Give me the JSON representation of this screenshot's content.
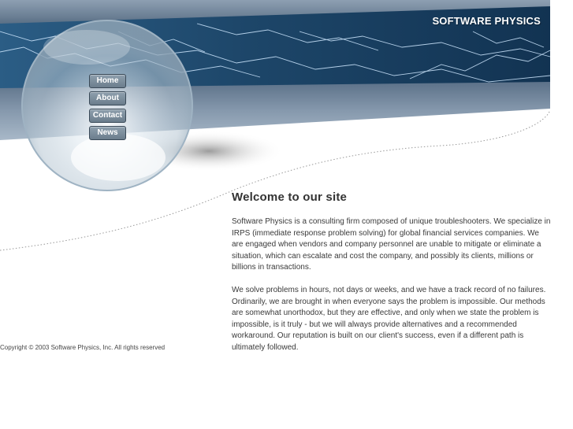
{
  "header": {
    "site_title": "SOFTWARE PHYSICS"
  },
  "nav": {
    "items": [
      {
        "label": "Home"
      },
      {
        "label": "About"
      },
      {
        "label": "Contact"
      },
      {
        "label": "News"
      }
    ]
  },
  "main": {
    "title": "Welcome to our site",
    "paragraphs": [
      "Software Physics is a consulting firm composed of unique troubleshooters. We specialize in IRPS (immediate response problem solving) for global financial services companies. We are engaged when vendors and company personnel are unable to mitigate or eliminate a situation, which can escalate and cost the company, and possibly its clients, millions or billions in transactions.",
      "We solve problems in hours, not days or weeks, and we have a track record of no failures. Ordinarily, we are brought in when everyone says the problem is impossible. Our methods are somewhat unorthodox, but they are effective, and only when we state the problem is impossible, is it truly - but we will always provide alternatives and a recommended workaround. Our reputation is built on our client's success, even if a different path is ultimately followed."
    ]
  },
  "footer": {
    "copyright": "Copyright © 2003 Software Physics, Inc. All rights reserved"
  },
  "colors": {
    "banner_dark": "#1b3d5e",
    "banner_mid": "#2e6187",
    "steel_band": "#7d90a4",
    "lightning": "#cfe8ff",
    "nav_button": "#7b8d9b",
    "heading_text": "#333333",
    "body_text": "#3a3a3a"
  },
  "icons": {
    "sphere": "glass-sphere-graphic",
    "lightning": "lightning-graphic"
  }
}
